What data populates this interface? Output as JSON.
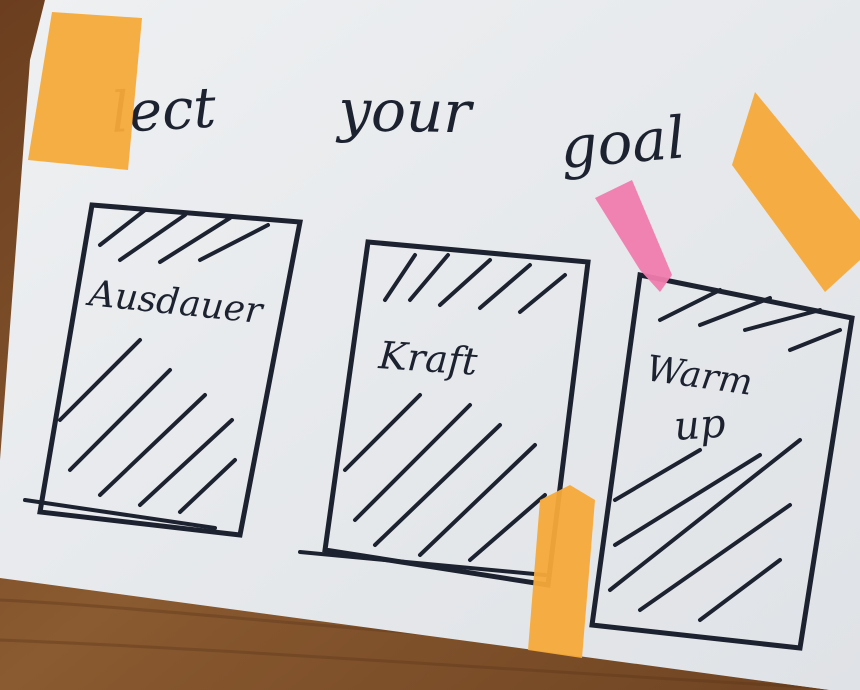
{
  "heading": {
    "word1": "lect",
    "word2": "your",
    "word3": "goal"
  },
  "cards": [
    {
      "label_line1": "Ausdauer",
      "label_line2": ""
    },
    {
      "label_line1": "Kraft",
      "label_line2": ""
    },
    {
      "label_line1": "Warm",
      "label_line2": "up"
    }
  ],
  "colors": {
    "wood": "#7a4a25",
    "paper": "#e9ecef",
    "ink": "#1d2230",
    "tape_orange": "#f5aa3a",
    "tape_pink": "#f07cae"
  }
}
